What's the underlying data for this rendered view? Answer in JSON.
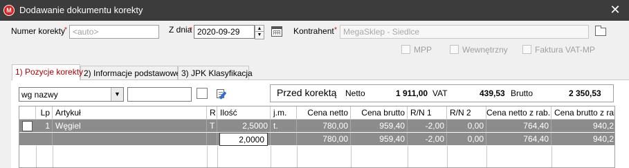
{
  "window": {
    "title": "Dodawanie dokumentu korekty",
    "app_icon_letter": "M",
    "close_glyph": "✕"
  },
  "header": {
    "number_label": "Numer  korekty",
    "required_mark": "*",
    "number_value": "<auto>",
    "date_label": "Z dnia",
    "date_value": "2020-09-29",
    "contractor_label": "Kontrahent",
    "contractor_value": "MegaSklep - Siedlce"
  },
  "flags": {
    "mpp": "MPP",
    "internal": "Wewnętrzny",
    "vat_mp": "Faktura VAT-MP"
  },
  "tabs": [
    {
      "label": "1) Pozycje korekty"
    },
    {
      "label": "2) Informacje podstawowe"
    },
    {
      "label": "3) JPK Klasyfikacja"
    }
  ],
  "filter": {
    "sort_value": "wg nazwy"
  },
  "summary": {
    "title": "Przed korektą",
    "netto_label": "Netto",
    "netto_value": "1 911,00",
    "vat_label": "VAT",
    "vat_value": "439,53",
    "brutto_label": "Brutto",
    "brutto_value": "2 350,53"
  },
  "grid": {
    "columns": [
      "Lp",
      "Artykuł",
      "R",
      "Ilość",
      "j.m.",
      "Cena netto",
      "Cena brutto",
      "R/N 1",
      "R/N 2",
      "Cena netto z rab.",
      "Cena brutto z rab."
    ],
    "rows": [
      {
        "lp": "1",
        "artykul": "Węgiel",
        "r": "T",
        "ilosc": "2,5000",
        "jm": "t.",
        "cena_netto": "780,00",
        "cena_brutto": "959,40",
        "rn1": "-2,00",
        "rn2": "0,00",
        "cena_netto_rab": "764,40",
        "cena_brutto_rab": "940,2"
      },
      {
        "lp": "",
        "artykul": "",
        "r": "",
        "ilosc": "2,0000",
        "jm": "",
        "cena_netto": "780,00",
        "cena_brutto": "959,40",
        "rn1": "-2,00",
        "rn2": "0,00",
        "cena_netto_rab": "764,40",
        "cena_brutto_rab": "940,2"
      }
    ]
  },
  "colors": {
    "titlebar": "#3c3c3c",
    "app_icon": "#e02121",
    "required": "#d00000",
    "active_tab_text": "#b00000",
    "row_selected": "#8c8c8c"
  }
}
